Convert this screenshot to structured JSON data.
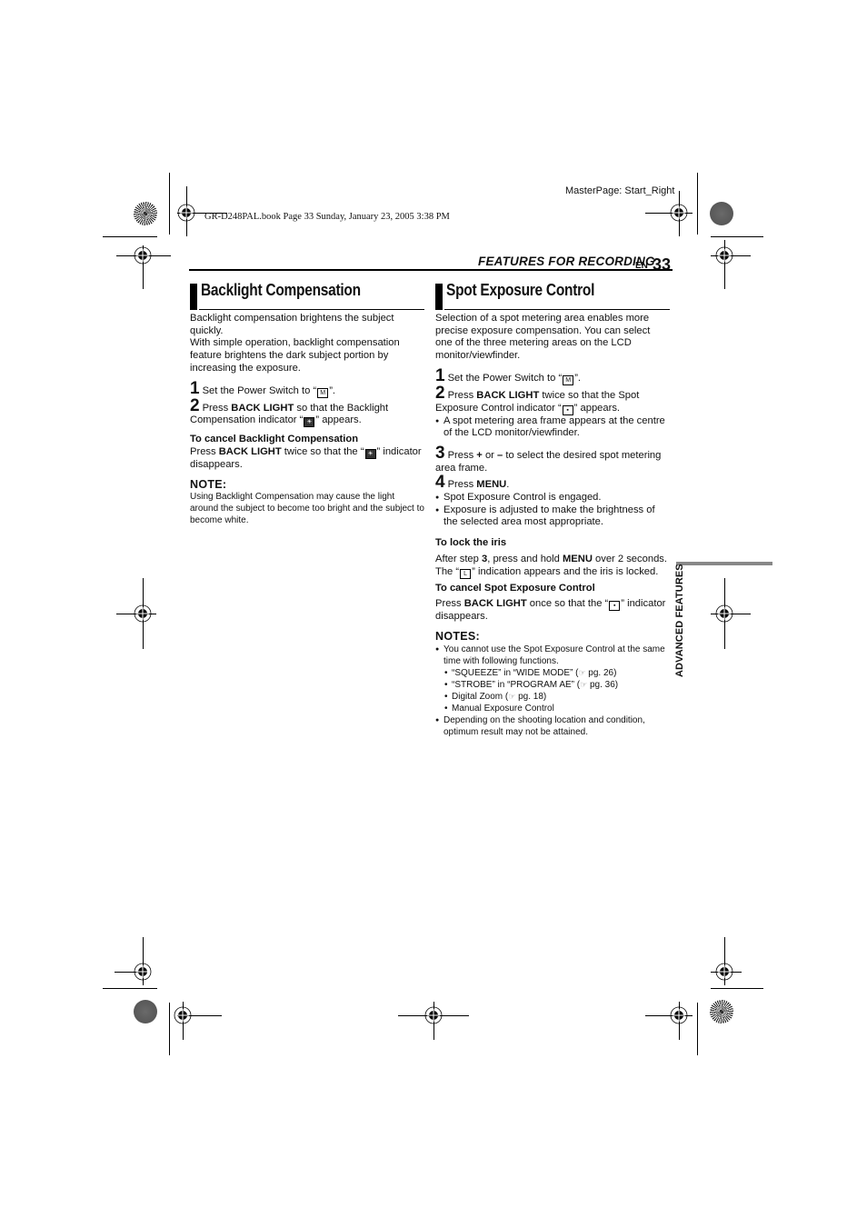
{
  "print_info": {
    "book_line": "GR-D248PAL.book  Page 33  Sunday, January 23, 2005  3:38 PM",
    "master_page": "MasterPage: Start_Right"
  },
  "header": {
    "section": "FEATURES FOR RECORDING",
    "language": "EN",
    "page_number": "33"
  },
  "side_tab": {
    "label": "ADVANCED FEATURES"
  },
  "backlight": {
    "title": "Backlight Compensation",
    "intro_1": "Backlight compensation brightens the subject quickly.",
    "intro_2": "With simple operation, backlight compensation feature brightens the dark subject portion by increasing the exposure.",
    "step1_num": "1",
    "step1_text": "Set the Power Switch to “",
    "step1_icon": "M",
    "step1_end": "”.",
    "step2_num": "2",
    "step2_pre": "Press ",
    "step2_bold": "BACK LIGHT",
    "step2_text": " so that the Backlight Compensation indicator “",
    "step2_end": "” appears.",
    "cancel_head": "To cancel Backlight Compensation",
    "cancel_pre": "Press ",
    "cancel_bold": "BACK LIGHT",
    "cancel_text": " twice so that the “",
    "cancel_end": "” indicator disappears.",
    "note_head": "NOTE:",
    "note_text": "Using Backlight Compensation may cause the light around the subject to become too bright and the subject to become white."
  },
  "spot": {
    "title": "Spot Exposure Control",
    "intro": "Selection of a spot metering area enables more precise exposure compensation. You can select one of the three metering areas on the LCD monitor/viewfinder.",
    "step1_num": "1",
    "step1_text": "Set the Power Switch to “",
    "step1_icon": "M",
    "step1_end": "”.",
    "step2_num": "2",
    "step2_pre": "Press ",
    "step2_bold": "BACK LIGHT",
    "step2_text": " twice so that the Spot Exposure Control indicator “",
    "step2_end": "” appears.",
    "step2_bullet": "A spot metering area frame appears at the centre of the LCD monitor/viewfinder.",
    "step3_num": "3",
    "step3_pre": "Press ",
    "step3_plus": "+",
    "step3_mid": " or ",
    "step3_minus": "–",
    "step3_text": " to select the desired spot metering area frame.",
    "step4_num": "4",
    "step4_pre": "Press ",
    "step4_bold": "MENU",
    "step4_end": ".",
    "step4_bullets": [
      "Spot Exposure Control is engaged.",
      "Exposure is adjusted to make the brightness of the selected area most appropriate."
    ],
    "lock_head": "To lock the iris",
    "lock_pre": "After step ",
    "lock_step": "3",
    "lock_mid": ", press and hold ",
    "lock_bold": "MENU",
    "lock_text": " over 2 seconds. The “",
    "lock_icon": "L",
    "lock_end": "” indication appears and the iris is locked.",
    "cancel_head": "To cancel Spot Exposure Control",
    "cancel_pre": "Press ",
    "cancel_bold": "BACK LIGHT",
    "cancel_text": " once so that the “",
    "cancel_end": "” indicator disappears.",
    "notes_head": "NOTES:",
    "notes_1": "You cannot use the Spot Exposure Control at the same time with following functions.",
    "notes_sub": [
      {
        "text": "“SQUEEZE” in “WIDE MODE” (",
        "ref": "☞",
        "page": " pg. 26)"
      },
      {
        "text": "“STROBE” in “PROGRAM AE” (",
        "ref": "☞",
        "page": " pg. 36)"
      },
      {
        "text": "Digital Zoom (",
        "ref": "☞",
        "page": " pg. 18)"
      },
      {
        "text": "Manual Exposure Control",
        "ref": "",
        "page": ""
      }
    ],
    "notes_2": "Depending on the shooting location and condition, optimum result may not be attained."
  },
  "icons": {
    "reg_mark": "registration-mark",
    "star_target": "star-target",
    "gray_disc": "gray-disc"
  }
}
